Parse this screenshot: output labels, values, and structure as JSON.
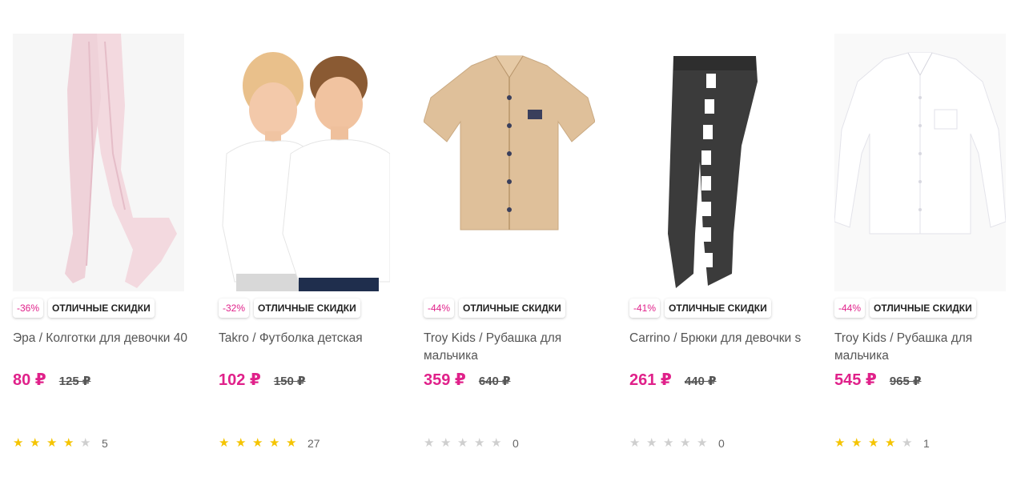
{
  "colors": {
    "accent": "#e0218a",
    "star_on": "#f5c400",
    "star_off": "#cfcfcf"
  },
  "products": [
    {
      "discount": "-36%",
      "promo": "ОТЛИЧНЫЕ СКИДКИ",
      "title": "Эра / Колготки для девочки 40",
      "price": "80 ₽",
      "old_price": "125 ₽",
      "rating": 4,
      "reviews": "5",
      "image": "white-tights-image"
    },
    {
      "discount": "-32%",
      "promo": "ОТЛИЧНЫЕ СКИДКИ",
      "title": "Takro / Футболка детская",
      "price": "102 ₽",
      "old_price": "150 ₽",
      "rating": 5,
      "reviews": "27",
      "image": "kids-tshirt-image"
    },
    {
      "discount": "-44%",
      "promo": "ОТЛИЧНЫЕ СКИДКИ",
      "title": "Troy Kids / Рубашка для мальчика",
      "price": "359 ₽",
      "old_price": "640 ₽",
      "rating": 0,
      "reviews": "0",
      "image": "beige-shirt-image"
    },
    {
      "discount": "-41%",
      "promo": "ОТЛИЧНЫЕ СКИДКИ",
      "title": "Carrino / Брюки для девочки s",
      "price": "261 ₽",
      "old_price": "440 ₽",
      "rating": 0,
      "reviews": "0",
      "image": "black-joggers-image"
    },
    {
      "discount": "-44%",
      "promo": "ОТЛИЧНЫЕ СКИДКИ",
      "title": "Troy Kids / Рубашка для мальчика",
      "price": "545 ₽",
      "old_price": "965 ₽",
      "rating": 4,
      "reviews": "1",
      "image": "white-shirt-image"
    }
  ]
}
